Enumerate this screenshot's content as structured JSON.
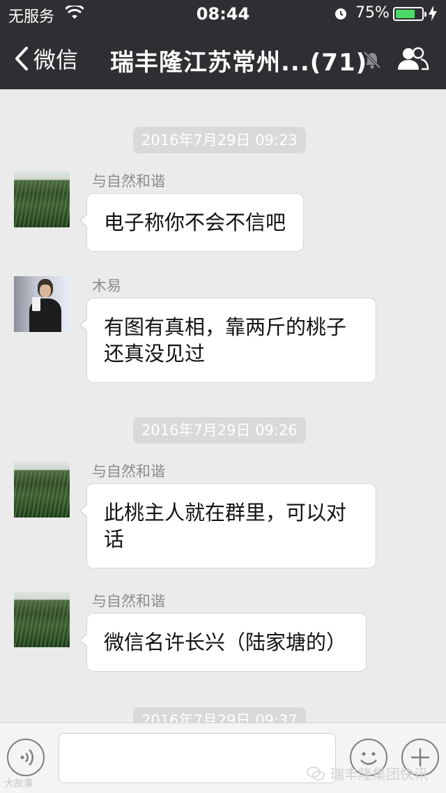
{
  "status_bar": {
    "carrier": "无服务",
    "time": "08:44",
    "battery_percent": "75%",
    "battery_level": 0.75,
    "icons": [
      "wifi-icon",
      "alarm-icon",
      "battery-icon",
      "charging-icon"
    ]
  },
  "nav": {
    "back_label": "微信",
    "title": "瑞丰隆江苏常州...(71)",
    "icons": [
      "back-chevron-icon",
      "mute-bell-icon",
      "group-contacts-icon"
    ]
  },
  "chat": {
    "timestamps": [
      "2016年7月29日 09:23",
      "2016年7月29日 09:26",
      "2016年7月29日 09:37"
    ],
    "messages": [
      {
        "sender": "与自然和谐",
        "text": "电子称你不会不信吧"
      },
      {
        "sender": "木易",
        "text": "有图有真相，靠两斤的桃子还真没见过"
      },
      {
        "sender": "与自然和谐",
        "text": "此桃主人就在群里，可以对话"
      },
      {
        "sender": "与自然和谐",
        "text": "微信名许长兴（陆家塘的）"
      }
    ]
  },
  "input_bar": {
    "icons": [
      "voice-icon",
      "emoji-icon",
      "plus-icon"
    ]
  },
  "watermarks": {
    "left": "大故事",
    "right": "瑞丰隆集团快讯"
  },
  "colors": {
    "header_bg": "#2f2f33",
    "chat_bg": "#ebebeb",
    "battery_green": "#4cd964",
    "bubble_bg": "#ffffff"
  }
}
